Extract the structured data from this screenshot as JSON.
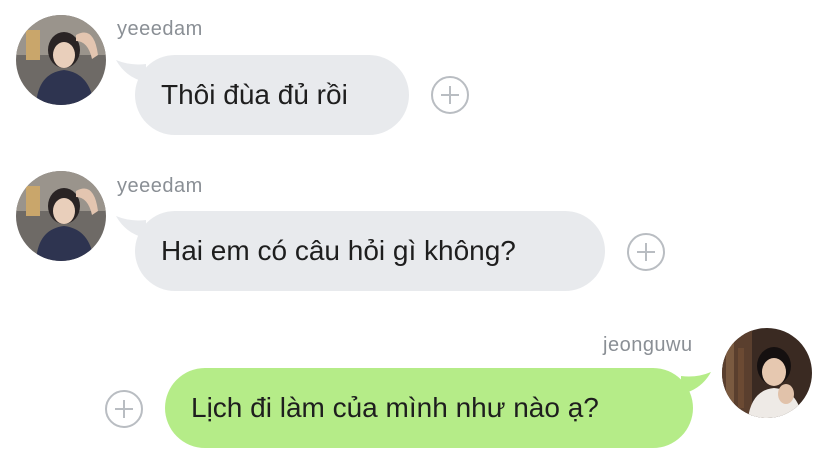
{
  "chat": {
    "messages": [
      {
        "sender": "yeeedam",
        "text": "Thôi đùa đủ rồi",
        "direction": "incoming",
        "avatar_icon": "avatar-photo-dark-hair-pajamas-icon"
      },
      {
        "sender": "yeeedam",
        "text": "Hai em có câu hỏi gì không?",
        "direction": "incoming",
        "avatar_icon": "avatar-photo-dark-hair-pajamas-icon"
      },
      {
        "sender": "jeonguwu",
        "text": "Lịch đi làm của mình như nào ạ?",
        "direction": "outgoing",
        "avatar_icon": "avatar-photo-light-shirt-icon"
      }
    ],
    "react_icon": "add-reaction-icon"
  },
  "colors": {
    "incoming_bubble": "#e8eaed",
    "outgoing_bubble": "#b5ec88",
    "sender_name": "#8a8f95",
    "react_button": "#b9bdc2"
  }
}
